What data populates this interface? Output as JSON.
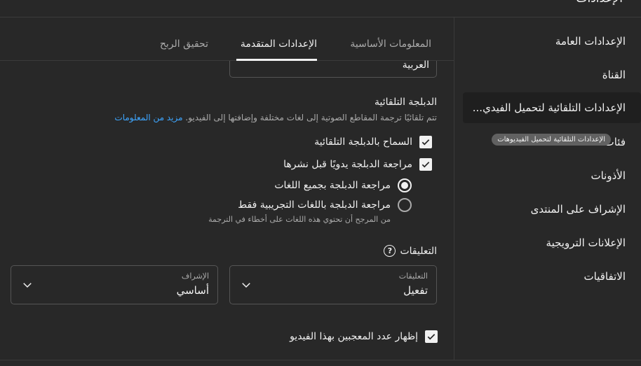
{
  "header": {
    "title": "الإعدادات"
  },
  "sidebar": {
    "items": [
      {
        "label": "الإعدادات العامة"
      },
      {
        "label": "القناة"
      },
      {
        "label": "الإعدادات التلقائية لتحميل الفيديوهات",
        "display": "الإعدادات التلقائية لتحميل الفيدي..."
      },
      {
        "label": "فئات"
      },
      {
        "label": "الأذونات"
      },
      {
        "label": "الإشراف على المنتدى"
      },
      {
        "label": "الإعلانات الترويجية"
      },
      {
        "label": "الاتفاقيات"
      }
    ],
    "tooltip": "الإعدادات التلقائية لتحميل الفيديوهات"
  },
  "tabs": [
    {
      "label": "المعلومات الأساسية"
    },
    {
      "label": "الإعدادات المتقدمة"
    },
    {
      "label": "تحقيق الربح"
    }
  ],
  "language_field": {
    "value": "العربية"
  },
  "dubbing": {
    "title": "الدبلجة التلقائية",
    "description": "تتم تلقائيًا ترجمة المقاطع الصوتية إلى لغات مختلفة وإضافتها إلى الفيديو.",
    "learn_more": "مزيد من المعلومات",
    "allow_label": "السماح بالدبلجة التلقائية",
    "review_label": "مراجعة الدبلجة يدويًا قبل نشرها",
    "radio_all": "مراجعة الدبلجة بجميع اللغات",
    "radio_experimental": "مراجعة الدبلجة باللغات التجريبية فقط",
    "radio_experimental_note": "من المرجح أن تحتوي هذه اللغات على أخطاء في الترجمة"
  },
  "comments": {
    "title": "التعليقات",
    "comments_select": {
      "label": "التعليقات",
      "value": "تفعيل"
    },
    "moderation_select": {
      "label": "الإشراف",
      "value": "أساسي"
    }
  },
  "likes": {
    "label": "إظهار عدد المعجبين بهذا الفيديو"
  }
}
